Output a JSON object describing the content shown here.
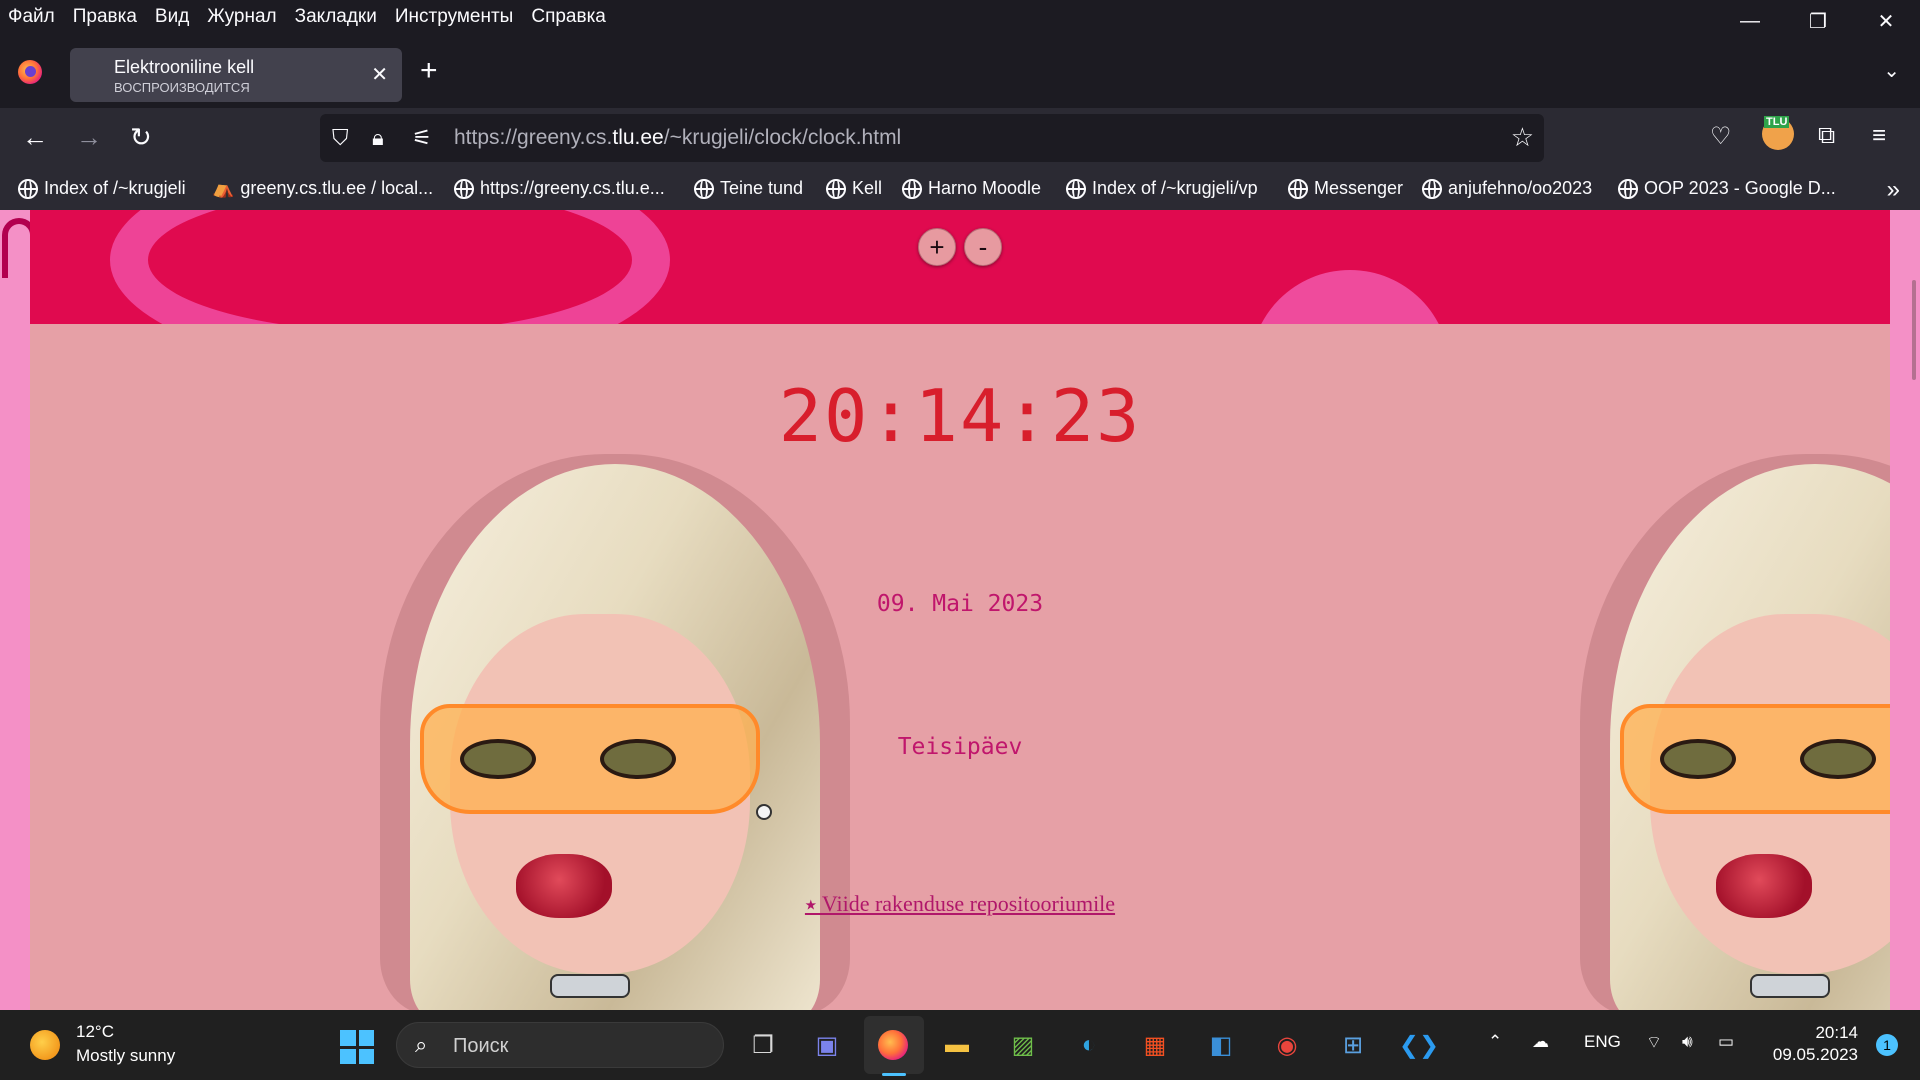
{
  "menubar": {
    "items": [
      "Файл",
      "Правка",
      "Вид",
      "Журнал",
      "Закладки",
      "Инструменты",
      "Справка"
    ]
  },
  "window": {
    "minimize_icon": "minimize-icon",
    "restore_icon": "restore-icon",
    "close_icon": "close-icon"
  },
  "tab": {
    "title": "Elektrooniline kell",
    "status": "ВОСПРОИЗВОДИТСЯ"
  },
  "address": {
    "prefix": "https://greeny.cs.",
    "host": "tlu.ee",
    "path": "/~krugjeli/clock/clock.html"
  },
  "bookmarks": [
    "Index of /~krugjeli",
    "greeny.cs.tlu.ee / local...",
    "https://greeny.cs.tlu.e...",
    "Teine tund",
    "Kell",
    "Harno Moodle",
    "Index of /~krugjeli/vp",
    "Messenger",
    "anjufehno/oo2023",
    "OOP 2023 - Google D..."
  ],
  "extension": {
    "badge": "TLU"
  },
  "page": {
    "zoom_in": "+",
    "zoom_out": "-",
    "time": "20:14:23",
    "date": "09. Mai 2023",
    "weekday": "Teisipäev",
    "repo_link": "⭑ Viide rakenduse repositooriumile"
  },
  "taskbar": {
    "weather_temp": "12°C",
    "weather_desc": "Mostly sunny",
    "search_placeholder": "Поиск",
    "lang": "ENG",
    "time": "20:14",
    "date": "09.05.2023",
    "notifications": "1"
  },
  "colors": {
    "clock": "#d81e2c",
    "date_text": "#c0166c",
    "header_band": "#e00a4f",
    "content_bg": "#e6a0a6"
  }
}
